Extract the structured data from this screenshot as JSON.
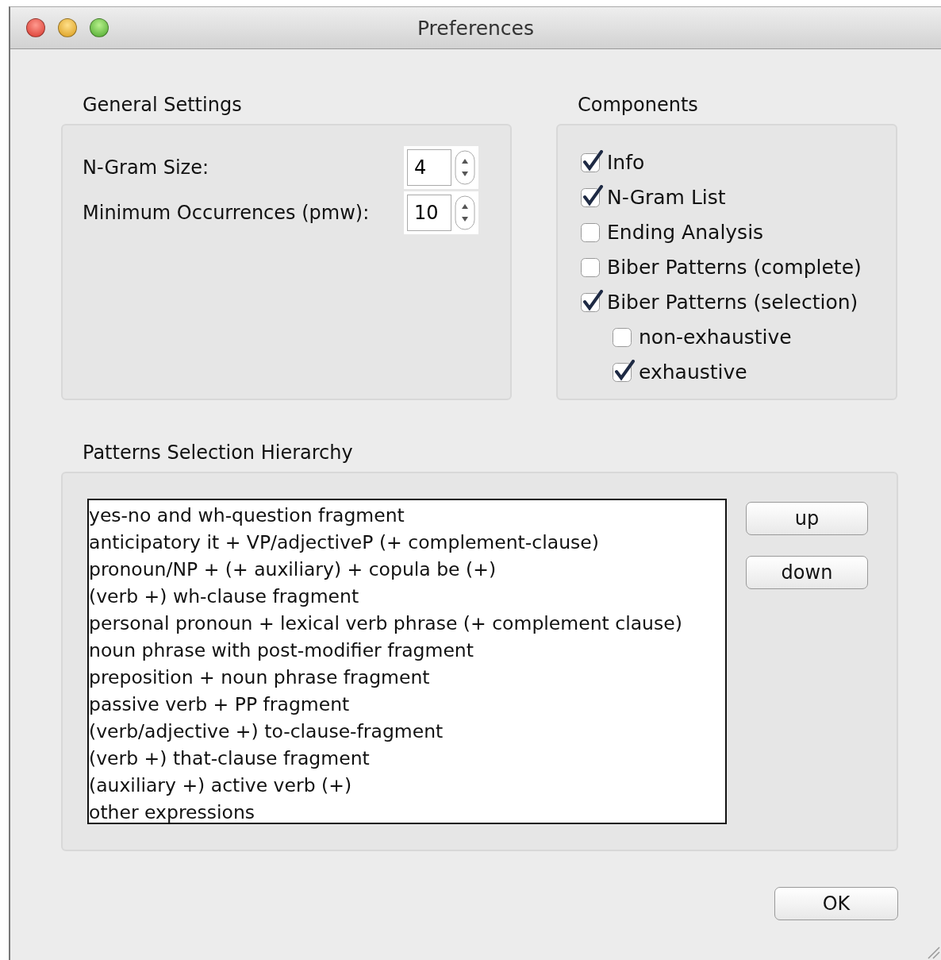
{
  "window": {
    "title": "Preferences"
  },
  "general_settings": {
    "title": "General Settings",
    "fields": [
      {
        "label": "N-Gram Size:",
        "value": "4"
      },
      {
        "label": "Minimum Occurrences (pmw):",
        "value": "10"
      }
    ]
  },
  "components": {
    "title": "Components",
    "items": [
      {
        "label": "Info",
        "checked": true
      },
      {
        "label": "N-Gram List",
        "checked": true
      },
      {
        "label": "Ending Analysis",
        "checked": false
      },
      {
        "label": "Biber Patterns (complete)",
        "checked": false
      },
      {
        "label": "Biber Patterns (selection)",
        "checked": true,
        "children": [
          {
            "label": "non-exhaustive",
            "checked": false
          },
          {
            "label": "exhaustive",
            "checked": true
          }
        ]
      }
    ]
  },
  "patterns": {
    "title": "Patterns Selection Hierarchy",
    "items": [
      "yes-no and wh-question fragment",
      "anticipatory it + VP/adjectiveP (+ complement-clause)",
      "pronoun/NP + (+ auxiliary) + copula be (+)",
      "(verb +) wh-clause fragment",
      "personal pronoun + lexical verb phrase (+ complement clause)",
      "noun phrase with post-modifier fragment",
      "preposition + noun phrase fragment",
      "passive verb + PP fragment",
      "(verb/adjective +) to-clause-fragment",
      "(verb +) that-clause fragment",
      "(auxiliary +) active verb (+)",
      "other expressions"
    ],
    "buttons": [
      "up",
      "down"
    ]
  },
  "ok_button": "OK"
}
